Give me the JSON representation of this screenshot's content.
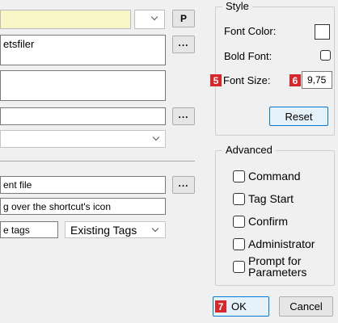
{
  "left": {
    "icon_picker_value": "",
    "p_button_label": "P",
    "path_field_value": "etsfiler",
    "browse_label": "...",
    "browse2_label": "...",
    "browse3_label": "...",
    "document_field_value": "ent file",
    "shortcut_hint_value": "g over the shortcut's icon",
    "tags_field_value": "e tags",
    "existing_tags_label": "Existing Tags"
  },
  "style_group": {
    "title": "Style",
    "font_color_label": "Font Color:",
    "bold_font_label": "Bold Font:",
    "font_size_label": "Font Size:",
    "font_size_value": "9,75",
    "reset_label": "Reset",
    "badge_5": "5",
    "badge_6": "6"
  },
  "advanced_group": {
    "title": "Advanced",
    "options": [
      "Command",
      "Tag Start",
      "Confirm",
      "Administrator",
      "Prompt for\nParameters"
    ]
  },
  "footer": {
    "badge_7": "7",
    "ok_label": "OK",
    "cancel_label": "Cancel"
  },
  "colors": {
    "highlight_field": "#fbf6c6",
    "badge_red": "#d9262a",
    "accent_blue": "#0078d7",
    "button_focus_bg": "#e5f1fb"
  }
}
